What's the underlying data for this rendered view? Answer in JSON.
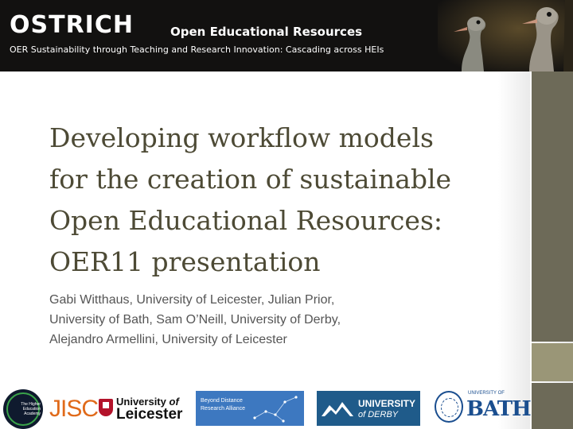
{
  "banner": {
    "brand": "OSTRICH",
    "tagline_main": "Open Educational Resources",
    "tagline_sub": "OER Sustainability through Teaching and Research Innovation: Cascading across HEIs"
  },
  "slide": {
    "title_lines": [
      "Developing workflow models",
      "for the creation of sustainable",
      "Open Educational Resources:",
      "OER11 presentation"
    ],
    "author_lines": [
      "Gabi Witthaus, University of Leicester, Julian Prior,",
      "University of Bath, Sam O’Neill, University of Derby,",
      "Alejandro Armellini, University of Leicester"
    ]
  },
  "logos": {
    "hea_text": "The Higher Education Academy",
    "jisc": "JISC",
    "leicester_top": "University",
    "leicester_of": "of",
    "leicester_name": "Leicester",
    "bdra_line1": "Beyond Distance",
    "bdra_line2": "Research Alliance",
    "derby_line1": "UNIVERSITY",
    "derby_line2": "of DERBY",
    "bath_top": "UNIVERSITY OF",
    "bath_name": "BATH"
  },
  "colors": {
    "title": "#4d4a35",
    "banner_bg": "#121110",
    "strip_dark": "#6d6a58",
    "strip_light": "#9a9677"
  }
}
